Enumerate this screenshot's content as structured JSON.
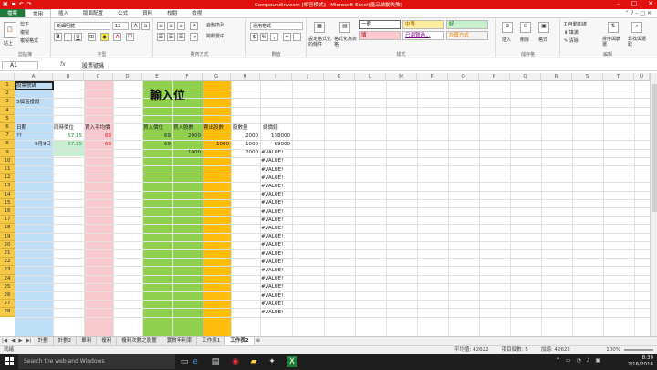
{
  "window": {
    "title": "Compoundinvesm [相容模式] - Microsoft Excel(產品啟動失敗)"
  },
  "tabs": [
    "檔案",
    "常用",
    "插入",
    "版面配置",
    "公式",
    "資料",
    "校閱",
    "檢視"
  ],
  "ribbon": {
    "clipboard": {
      "label": "剪貼簿",
      "paste": "貼上",
      "cut": "剪下",
      "copy": "複製",
      "painter": "複製格式"
    },
    "font": {
      "label": "字型",
      "name": "新細明體",
      "size": "12"
    },
    "alignment": {
      "label": "對齊方式",
      "wrap": "自動換列",
      "merge": "跨欄置中"
    },
    "number": {
      "label": "數值",
      "format": "通用格式"
    },
    "styles": {
      "label": "樣式",
      "conditional": "設定格式化的條件",
      "table": "格式化為表格",
      "normal": "一般",
      "medium": "中等",
      "good": "好",
      "bad": "壞",
      "visited": "已瀏覽過...",
      "calc": "計算方式"
    },
    "cells": {
      "label": "儲存格",
      "insert": "插入",
      "delete": "刪除",
      "format": "格式"
    },
    "editing": {
      "label": "編輯",
      "autosum": "自動加總",
      "fill": "填滿",
      "clear": "清除",
      "sort": "排序與篩選",
      "find": "尋找與選取"
    }
  },
  "formula_bar": {
    "name_box": "A1",
    "fx": "fx",
    "content": "股票號碼"
  },
  "columns": [
    "A",
    "B",
    "C",
    "D",
    "E",
    "F",
    "G",
    "H",
    "I",
    "J",
    "K",
    "L",
    "M",
    "N",
    "O",
    "P",
    "Q",
    "R",
    "S",
    "T",
    "U"
  ],
  "rows": [
    "1",
    "2",
    "3",
    "4",
    "5",
    "6",
    "7",
    "8",
    "9",
    "10",
    "11",
    "12",
    "13",
    "14",
    "15",
    "16",
    "17",
    "18",
    "19",
    "20",
    "21",
    "22",
    "23",
    "24",
    "25",
    "26",
    "27",
    "28"
  ],
  "cells": {
    "A1": "股票號碼",
    "A3": "5個置投股",
    "A6": "日期",
    "A7": "??",
    "A8": "9月9日",
    "E2": "輸入位",
    "B6": "同時價位",
    "C6": "買入平均價",
    "E6": "買入價位",
    "F6": "買入股數",
    "G6": "賣出股數",
    "H6": "股數量",
    "I6": "總價錢",
    "B7": "57.15",
    "C7": "69",
    "E7": "69",
    "F7": "2000",
    "H7": "2000",
    "I7": "138000",
    "B8": "57.15",
    "C8": "69",
    "E8": "69",
    "G8": "1000",
    "H8": "1000",
    "I8": "69000",
    "F9": "1000",
    "H9": "2000",
    "value_error": "#VALUE!"
  },
  "sheet_tabs": [
    "計劃",
    "計劃2",
    "單利",
    "複利",
    "複利次數之影響",
    "實質年利率",
    "工作表1",
    "工作表2"
  ],
  "active_sheet": "工作表2",
  "status": {
    "ready": "就緒",
    "average": "平均值: 42622",
    "count": "項目個數: 5",
    "sum": "加總: 42622",
    "zoom": "100%"
  },
  "taskbar": {
    "search": "Search the web and Windows",
    "time": "8:39",
    "date": "2/16/2016"
  }
}
